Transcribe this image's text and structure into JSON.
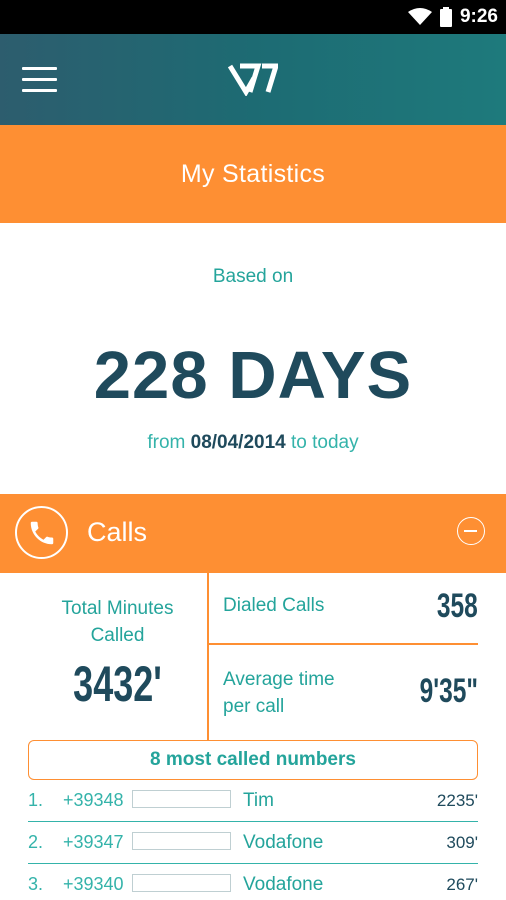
{
  "status_bar": {
    "time": "9:26"
  },
  "app_bar": {
    "menu_icon": "hamburger-icon",
    "logo_icon": "app-logo-icon"
  },
  "title": "My Statistics",
  "period": {
    "based_on": "Based on",
    "days": "228 DAYS",
    "from": "from",
    "start_date": "08/04/2014",
    "to_today": "to today"
  },
  "calls": {
    "title": "Calls",
    "icon": "phone-icon",
    "collapse_icon": "minus-circle-icon",
    "total_minutes_label_1": "Total Minutes",
    "total_minutes_label_2": "Called",
    "total_minutes_value": "3432'",
    "dialed_calls_label": "Dialed Calls",
    "dialed_calls_value": "358",
    "avg_time_label_1": "Average time",
    "avg_time_label_2": "per call",
    "avg_time_value": "9'35\""
  },
  "most_called": {
    "header": "8 most called numbers",
    "rows": [
      {
        "index": "1.",
        "number": "+39348",
        "carrier": "Tim",
        "minutes": "2235'"
      },
      {
        "index": "2.",
        "number": "+39347",
        "carrier": "Vodafone",
        "minutes": "309'"
      },
      {
        "index": "3.",
        "number": "+39340",
        "carrier": "Vodafone",
        "minutes": "267'"
      }
    ]
  },
  "colors": {
    "orange": "#fe8f33",
    "teal": "#24a49b",
    "navy": "#1f4a5c",
    "header": "#1d6b73"
  }
}
